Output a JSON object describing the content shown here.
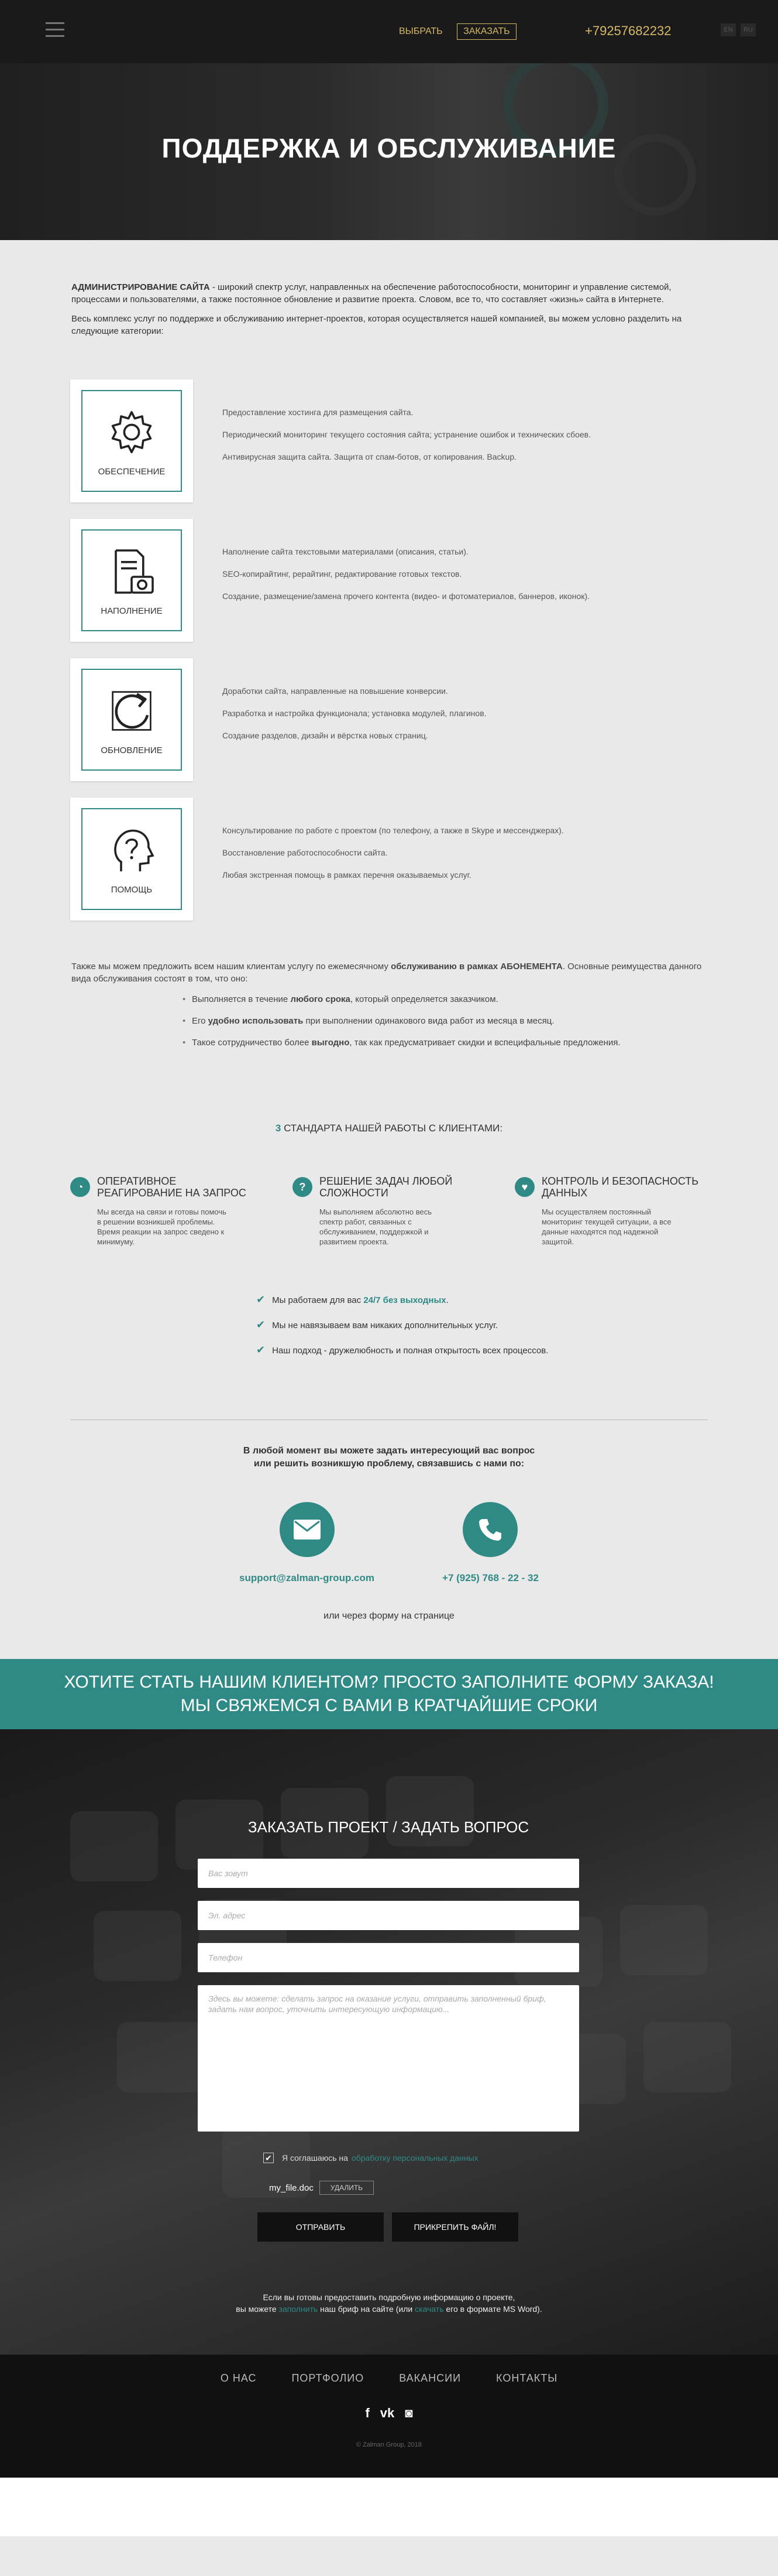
{
  "top": {
    "nav_select": "ВЫБРАТЬ",
    "nav_order": "ЗАКАЗАТЬ",
    "phone": "+79257682232",
    "langs": [
      "EN",
      "RU"
    ]
  },
  "hero": {
    "title": "ПОДДЕРЖКА И ОБСЛУЖИВАНИЕ"
  },
  "intro": {
    "p1_bold": "АДМИНИСТРИРОВАНИЕ САЙТА",
    "p1_rest": " - широкий спектр услуг, направленных на обеспечение работоспособности, мониторинг и управление системой, процессами и пользователями, а также постоянное обновление и развитие проекта. Словом, все то, что составляет «жизнь» сайта в Интернете.",
    "p2": "Весь комплекс услуг по поддержке и обслуживанию интернет-проектов, которая осуществляется нашей компанией, вы можем условно разделить на следующие категории:"
  },
  "services": [
    {
      "title": "ОБЕСПЕЧЕНИЕ",
      "icon": "gear-icon",
      "items": [
        "Предоставление хостинга для размещения сайта.",
        "Периодический мониторинг текущего состояния сайта; устранение ошибок и технических сбоев.",
        "Антивирусная защита сайта. Защита от спам-ботов, от копирования. Backup."
      ]
    },
    {
      "title": "НАПОЛНЕНИЕ",
      "icon": "document-camera-icon",
      "items": [
        "Наполнение сайта текстовыми материалами (описания, статьи).",
        "SEO-копирайтинг, рерайтинг, редактирование готовых текстов.",
        "Создание, размещение/замена прочего контента (видео- и фотоматериалов, баннеров, иконок)."
      ]
    },
    {
      "title": "ОБНОВЛЕНИЕ",
      "icon": "refresh-icon",
      "items": [
        "Доработки сайта, направленные на повышение конверсии.",
        "Разработка и настройка функционала; установка модулей, плагинов.",
        "Создание разделов, дизайн и вёрстка новых страниц."
      ]
    },
    {
      "title": "ПОМОЩЬ",
      "icon": "head-question-icon",
      "items": [
        "Консультирование по работе с проектом (по телефону, а также в Skype и мессенджерах).",
        "Восстановление работоспособности сайта.",
        "Любая экстренная помощь в рамках перечня оказываемых услуг."
      ]
    }
  ],
  "abon": {
    "p_start": "Также мы можем предложить всем нашим клиентам услугу по ежемесячному ",
    "p_bold": "обслуживанию в рамках АБОНЕМЕНТА",
    "p_end": ". Основные реимущества данного вида обслуживания состоят в том, что оно:",
    "bullets": [
      {
        "a": "Выполняется в течение ",
        "b": "любого срока",
        "c": ", который определяется заказчиком."
      },
      {
        "a": "Его ",
        "b": "удобно использовать",
        "c": " при выполнении одинакового вида работ из месяца в месяц."
      },
      {
        "a": "Такое сотрудничество более ",
        "b": "выгодно",
        "c": ", так как предусматривает скидки и вспецифальные предложения."
      }
    ]
  },
  "standards": {
    "num": "3",
    "heading": " СТАНДАРТА НАШЕЙ РАБОТЫ С КЛИЕНТАМИ:",
    "items": [
      {
        "icon": "clock-icon",
        "glyph": "◔",
        "title": "ОПЕРАТИВНОЕ РЕАГИРОВАНИЕ НА ЗАПРОС",
        "text": "Мы всегда на связи и готовы помочь в решении возникшей проблемы. Время реакции на запрос сведено к минимуму."
      },
      {
        "icon": "question-icon",
        "glyph": "?",
        "title": "РЕШЕНИЕ ЗАДАЧ ЛЮБОЙ СЛОЖНОСТИ",
        "text": "Мы выполняем абсолютно весь спектр работ, связанных с обслуживанием, поддержкой и развитием проекта."
      },
      {
        "icon": "shield-icon",
        "glyph": "♥",
        "title": "КОНТРОЛЬ И БЕЗОПАСНОСТЬ ДАННЫХ",
        "text": "Мы осуществляем постоянный мониторинг текущей ситуации, а все данные находятся под надежной защитой."
      }
    ]
  },
  "checks": {
    "c1_a": "Мы работаем для вас ",
    "c1_b": "24/7 без выходных",
    "c1_c": ".",
    "c2": "Мы не навязываем вам никаких дополнительных услуг.",
    "c3": "Наш подход - дружелюбность и полная открытость всех процессов."
  },
  "contact": {
    "lead1": "В любой момент вы можете задать интересующий вас вопрос",
    "lead2": "или решить возникшую проблему, связавшись с нами по:",
    "email": "support@zalman-group.com",
    "phone": "+7 (925) 768 - 22 - 32",
    "or": "или через форму на странице"
  },
  "cta": {
    "line1": "ХОТИТЕ СТАТЬ НАШИМ КЛИЕНТОМ? ПРОСТО ЗАПОЛНИТЕ ФОРМУ ЗАКАЗА!",
    "line2": "МЫ СВЯЖЕМСЯ С ВАМИ В КРАТЧАЙШИЕ СРОКИ"
  },
  "form": {
    "title": "ЗАКАЗАТЬ ПРОЕКТ / ЗАДАТЬ ВОПРОС",
    "name_ph": "Вас зовут",
    "email_ph": "Эл. адрес",
    "phone_ph": "Телефон",
    "msg_ph": "Здесь вы можете: сделать запрос на оказание услуги, отправить заполненный бриф, задать нам вопрос, уточнить интересующую информацию...",
    "agree_text": "Я соглашаюсь на",
    "agree_link": "обработку персональных данных",
    "file_name": "my_file.doc",
    "file_delete": "УДАЛИТЬ",
    "send": "ОТПРАВИТЬ",
    "attach": "ПРИКРЕПИТЬ ФАЙЛ!",
    "note1": "Если вы готовы предоставить подробную информацию о проекте,",
    "note2_a": "вы можете ",
    "note2_link1": "заполнить",
    "note2_b": " наш бриф на сайте (или ",
    "note2_link2": "скачать",
    "note2_c": " его в формате MS Word)."
  },
  "footer": {
    "nav": [
      "О НАС",
      "ПОРТФОЛИО",
      "ВАКАНСИИ",
      "КОНТАКТЫ"
    ],
    "social": [
      "f",
      "vk",
      "◙"
    ],
    "copy": "© Zalman Group, 2018"
  },
  "colors": {
    "accent": "#2f8a86",
    "gold": "#d6b968",
    "dark": "#1a1a1a"
  }
}
